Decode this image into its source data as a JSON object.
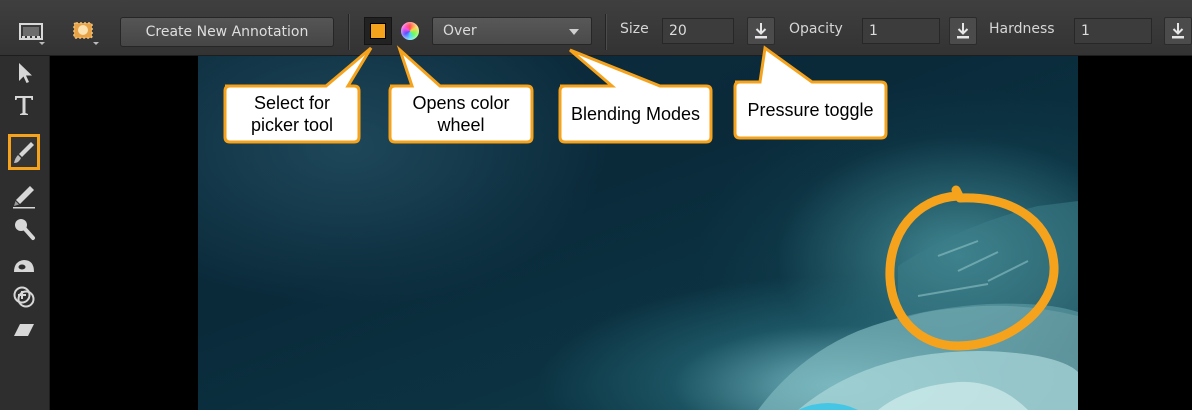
{
  "toolbar": {
    "create_annotation_label": "Create New Annotation",
    "color_swatch": "#f5a21c",
    "blend_mode": "Over",
    "size_label": "Size",
    "size_value": "20",
    "opacity_label": "Opacity",
    "opacity_value": "1",
    "hardness_label": "Hardness",
    "hardness_value": "1",
    "icons": [
      "annotation-viewer-icon",
      "annotation-layers-icon",
      "color-wheel-icon",
      "pressure-toggle-icon"
    ]
  },
  "tools": [
    {
      "name": "select-tool",
      "icon": "arrow-pointer-icon"
    },
    {
      "name": "text-tool",
      "icon": "text-t-icon"
    },
    {
      "name": "brush-tool",
      "icon": "paintbrush-icon",
      "active": true
    },
    {
      "name": "pencil-tool",
      "icon": "pencil-icon"
    },
    {
      "name": "magnify-tool",
      "icon": "magnifier-icon"
    },
    {
      "name": "blur-tool",
      "icon": "blob-icon"
    },
    {
      "name": "clone-tool",
      "icon": "clone-stamp-icon"
    },
    {
      "name": "eraser-tool",
      "icon": "eraser-icon"
    }
  ],
  "callouts": [
    {
      "text": "Select for picker tool"
    },
    {
      "text": "Opens color wheel"
    },
    {
      "text": "Blending Modes"
    },
    {
      "text": "Pressure toggle"
    }
  ],
  "colors": {
    "accent": "#f5a21c",
    "toolbar_bg": "#3a3a3a",
    "callout_fill": "#ffffff"
  }
}
